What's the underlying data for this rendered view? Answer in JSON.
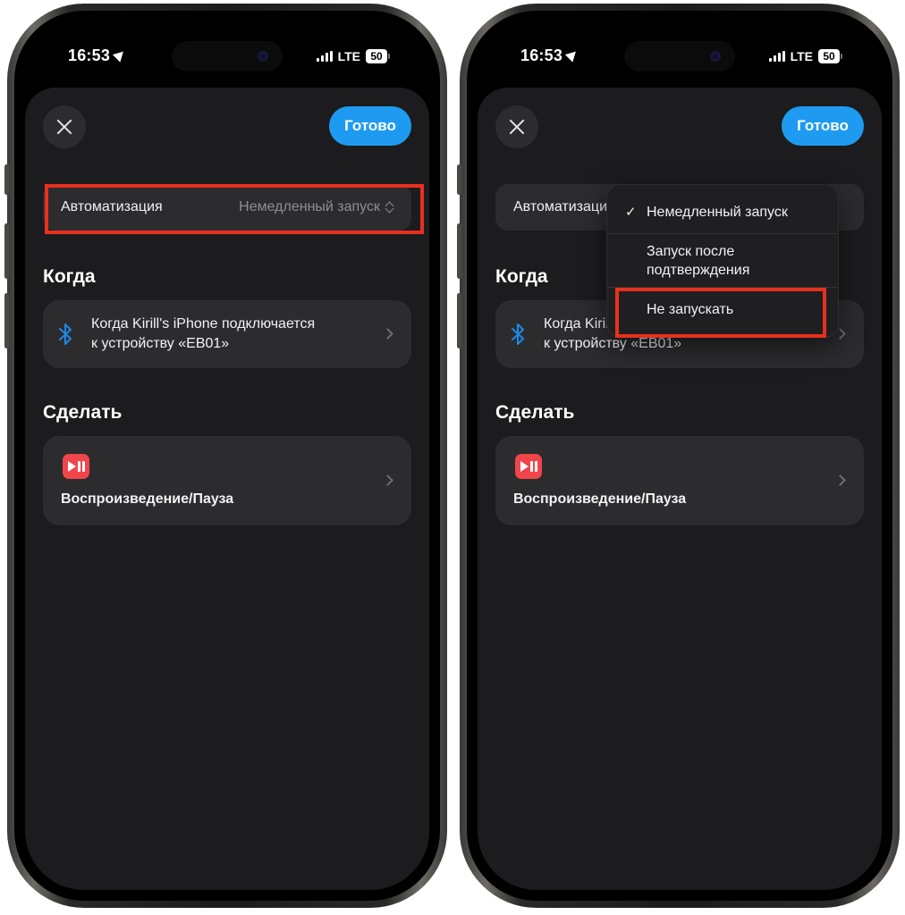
{
  "status": {
    "time": "16:53",
    "network": "LTE",
    "battery": "50"
  },
  "header": {
    "done_label": "Готово"
  },
  "automation": {
    "label": "Автоматизация",
    "value": "Немедленный запуск"
  },
  "when": {
    "title": "Когда",
    "line1": "Когда Kirill's iPhone подключается",
    "line2": "к устройству «EB01»"
  },
  "do": {
    "title": "Сделать",
    "action": "Воспроизведение/Пауза"
  },
  "menu": {
    "items": [
      {
        "label": "Немедленный запуск",
        "selected": true
      },
      {
        "label1": "Запуск после",
        "label2": "подтверждения",
        "selected": false
      },
      {
        "label": "Не запускать",
        "selected": false
      }
    ],
    "check_glyph": "✓"
  },
  "colors": {
    "accent": "#1e9bf0",
    "highlight": "#e8301e",
    "action_icon": "#f0454a",
    "bluetooth": "#1e88e5"
  },
  "icons": [
    "close-icon",
    "location-arrow-icon",
    "signal-icon",
    "battery-icon",
    "updown-chevron-icon",
    "bluetooth-icon",
    "chevron-right-icon",
    "play-pause-icon",
    "checkmark-icon"
  ]
}
